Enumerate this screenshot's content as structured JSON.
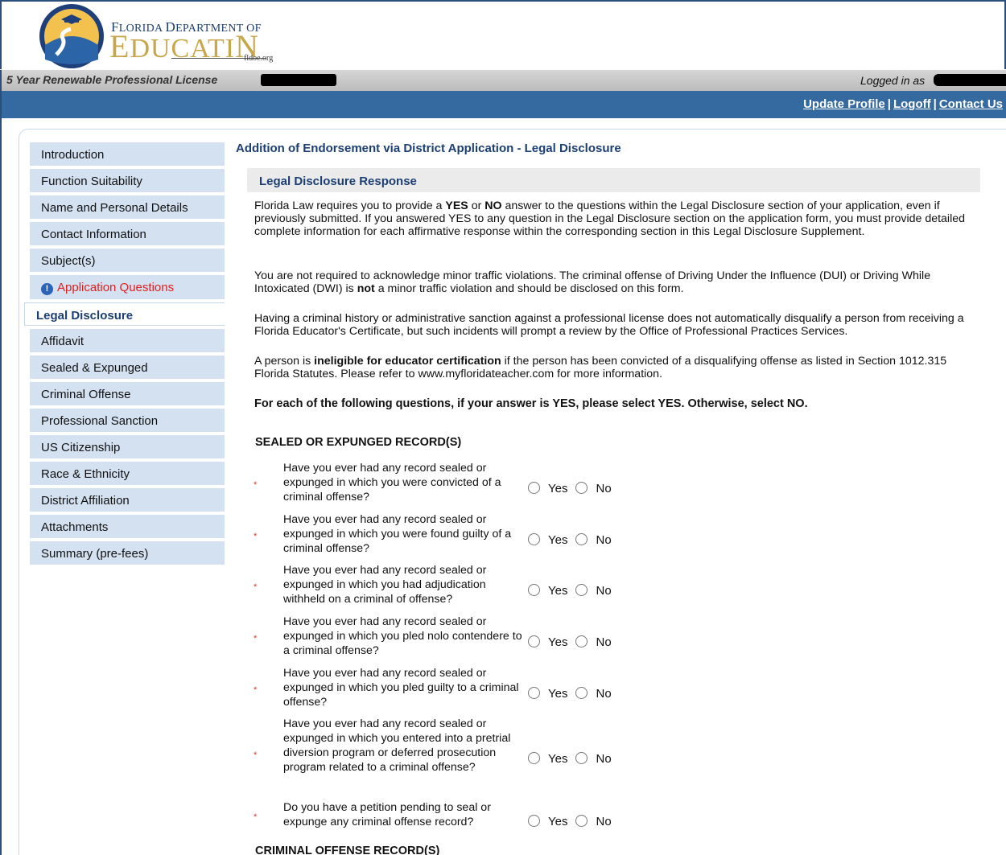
{
  "header": {
    "logo_line1_cap": "F",
    "logo_line1_rest": "LORIDA ",
    "logo_line1_cap2": "D",
    "logo_line1_rest2": "EPARTMENT OF",
    "logo_line2_cap": "E",
    "logo_line2_rest": "DUCATI",
    "logo_line2_end": "N",
    "logo_url": "fldoe.org",
    "license_title": "5 Year Renewable Professional License",
    "logged_in_label": "Logged in as",
    "links": {
      "update_profile": "Update Profile",
      "logoff": "Logoff",
      "contact_us": "Contact Us",
      "separator": "|"
    }
  },
  "sidebar": {
    "items": [
      {
        "label": "Introduction"
      },
      {
        "label": "Function Suitability"
      },
      {
        "label": "Name and Personal Details"
      },
      {
        "label": "Contact Information"
      },
      {
        "label": "Subject(s)"
      },
      {
        "label": "Application Questions",
        "status": "error"
      },
      {
        "label": "Legal Disclosure",
        "status": "active"
      },
      {
        "label": "Affidavit"
      },
      {
        "label": "Sealed & Expunged"
      },
      {
        "label": "Criminal Offense"
      },
      {
        "label": "Professional Sanction"
      },
      {
        "label": "US Citizenship"
      },
      {
        "label": "Race & Ethnicity"
      },
      {
        "label": "District Affiliation"
      },
      {
        "label": "Attachments"
      },
      {
        "label": "Summary (pre-fees)"
      }
    ]
  },
  "main": {
    "page_title": "Addition of Endorsement via District Application - Legal Disclosure",
    "section_title": "Legal Disclosure Response",
    "p1": {
      "a": "Florida Law requires you to provide a ",
      "yes": "YES",
      "b": " or ",
      "no": "NO",
      "c": " answer to the questions within the Legal Disclosure section of your application, even if previously submitted. If you answered YES to any question in the Legal Disclosure section on the application form, you must provide detailed complete information for each affirmative response within the corresponding section in this Legal Disclosure Supplement."
    },
    "p2": {
      "a": "You are not required to acknowledge minor traffic violations. The criminal offense of Driving Under the Influence (DUI) or Driving While Intoxicated (DWI) is ",
      "not": "not",
      "b": " a minor traffic violation and should be disclosed on this form."
    },
    "p3": "Having a criminal history or administrative sanction against a professional license does not automatically disqualify a person from receiving a Florida Educator's Certificate, but such incidents will prompt a review by the Office of Professional Practices Services.",
    "p4": {
      "a": "A person is ",
      "bold": "ineligible for educator certification",
      "b": " if the person has been convicted of a disqualifying offense as listed in Section 1012.315 Florida Statutes. Please refer to www.myfloridateacher.com for more information."
    },
    "instruction": "For each of the following questions, if your answer is YES, please select YES. Otherwise, select NO.",
    "sealed_title": "SEALED OR EXPUNGED RECORD(S)",
    "criminal_title": "CRIMINAL OFFENSE RECORD(S)",
    "required_mark": "*",
    "yes_label": "Yes",
    "no_label": "No",
    "questions": [
      {
        "text": "Have you ever had any record sealed or expunged in which you were convicted of a criminal offense?"
      },
      {
        "text": "Have you ever had any record sealed or expunged in which you were found guilty of a criminal offense?"
      },
      {
        "text": "Have you ever had any record sealed or expunged in which you had adjudication withheld on a criminal of offense?"
      },
      {
        "text": "Have you ever had any record sealed or expunged in which you pled nolo contendere to a criminal offense?"
      },
      {
        "text": "Have you ever had any record sealed or expunged in which you pled guilty to a criminal offense?"
      },
      {
        "text": "Have you ever had any record sealed or expunged in which you entered into a pretrial diversion program or deferred prosecution program related to a criminal offense?"
      },
      {
        "text": "Do you have a petition pending to seal or expunge any criminal offense record?"
      }
    ]
  }
}
